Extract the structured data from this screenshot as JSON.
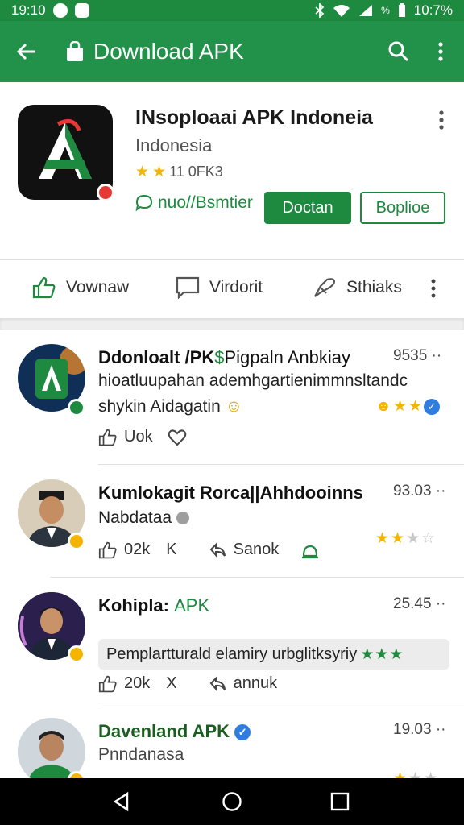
{
  "status_bar": {
    "time_left": "19:10",
    "battery_percent_label": "%",
    "time_right": "10:7%"
  },
  "app_bar": {
    "title": "Download APK"
  },
  "app": {
    "name": "INsoploaai APK Indoneia",
    "subtitle": "Indonesia",
    "rating_text": "11 0FK3",
    "stars": 2,
    "action_link": "nuo//Bsmtier",
    "primary_button": "Doctan",
    "outline_button": "Boplioe"
  },
  "actions": {
    "like": "Vownaw",
    "comment": "Virdorit",
    "share": "Sthiaks"
  },
  "posts": [
    {
      "title": "Ddonloalt /PK",
      "title_green": "$",
      "title_rest": "Pigpaln Anbkiay",
      "time": "9535",
      "text1": "hioatluupahan ademhgartienimmnsltandc",
      "text2": "shykin Aidagatin",
      "stat1": "Uok",
      "stars": 3
    },
    {
      "title": "Kumlokagit Rorca||Ahhdooinns",
      "time": "93.03",
      "text1": "Nabdataa",
      "stat1": "02k",
      "stat1_x": "K",
      "stat2": "Sanok",
      "stars": 2
    },
    {
      "title": "Kohipla:",
      "title_green": "APK",
      "time": "25.45",
      "pill": "Pemplartturald elamiry urbglitksyriy",
      "stat1": "20k",
      "stat1_x": "X",
      "stat2": "annuk"
    },
    {
      "title": "Davenland APK",
      "time": "19.03",
      "text1": "Pnndanasa"
    }
  ],
  "colors": {
    "primary_green": "#1e8a3f",
    "appbar_green": "#22914a",
    "star_gold": "#f4b400"
  }
}
